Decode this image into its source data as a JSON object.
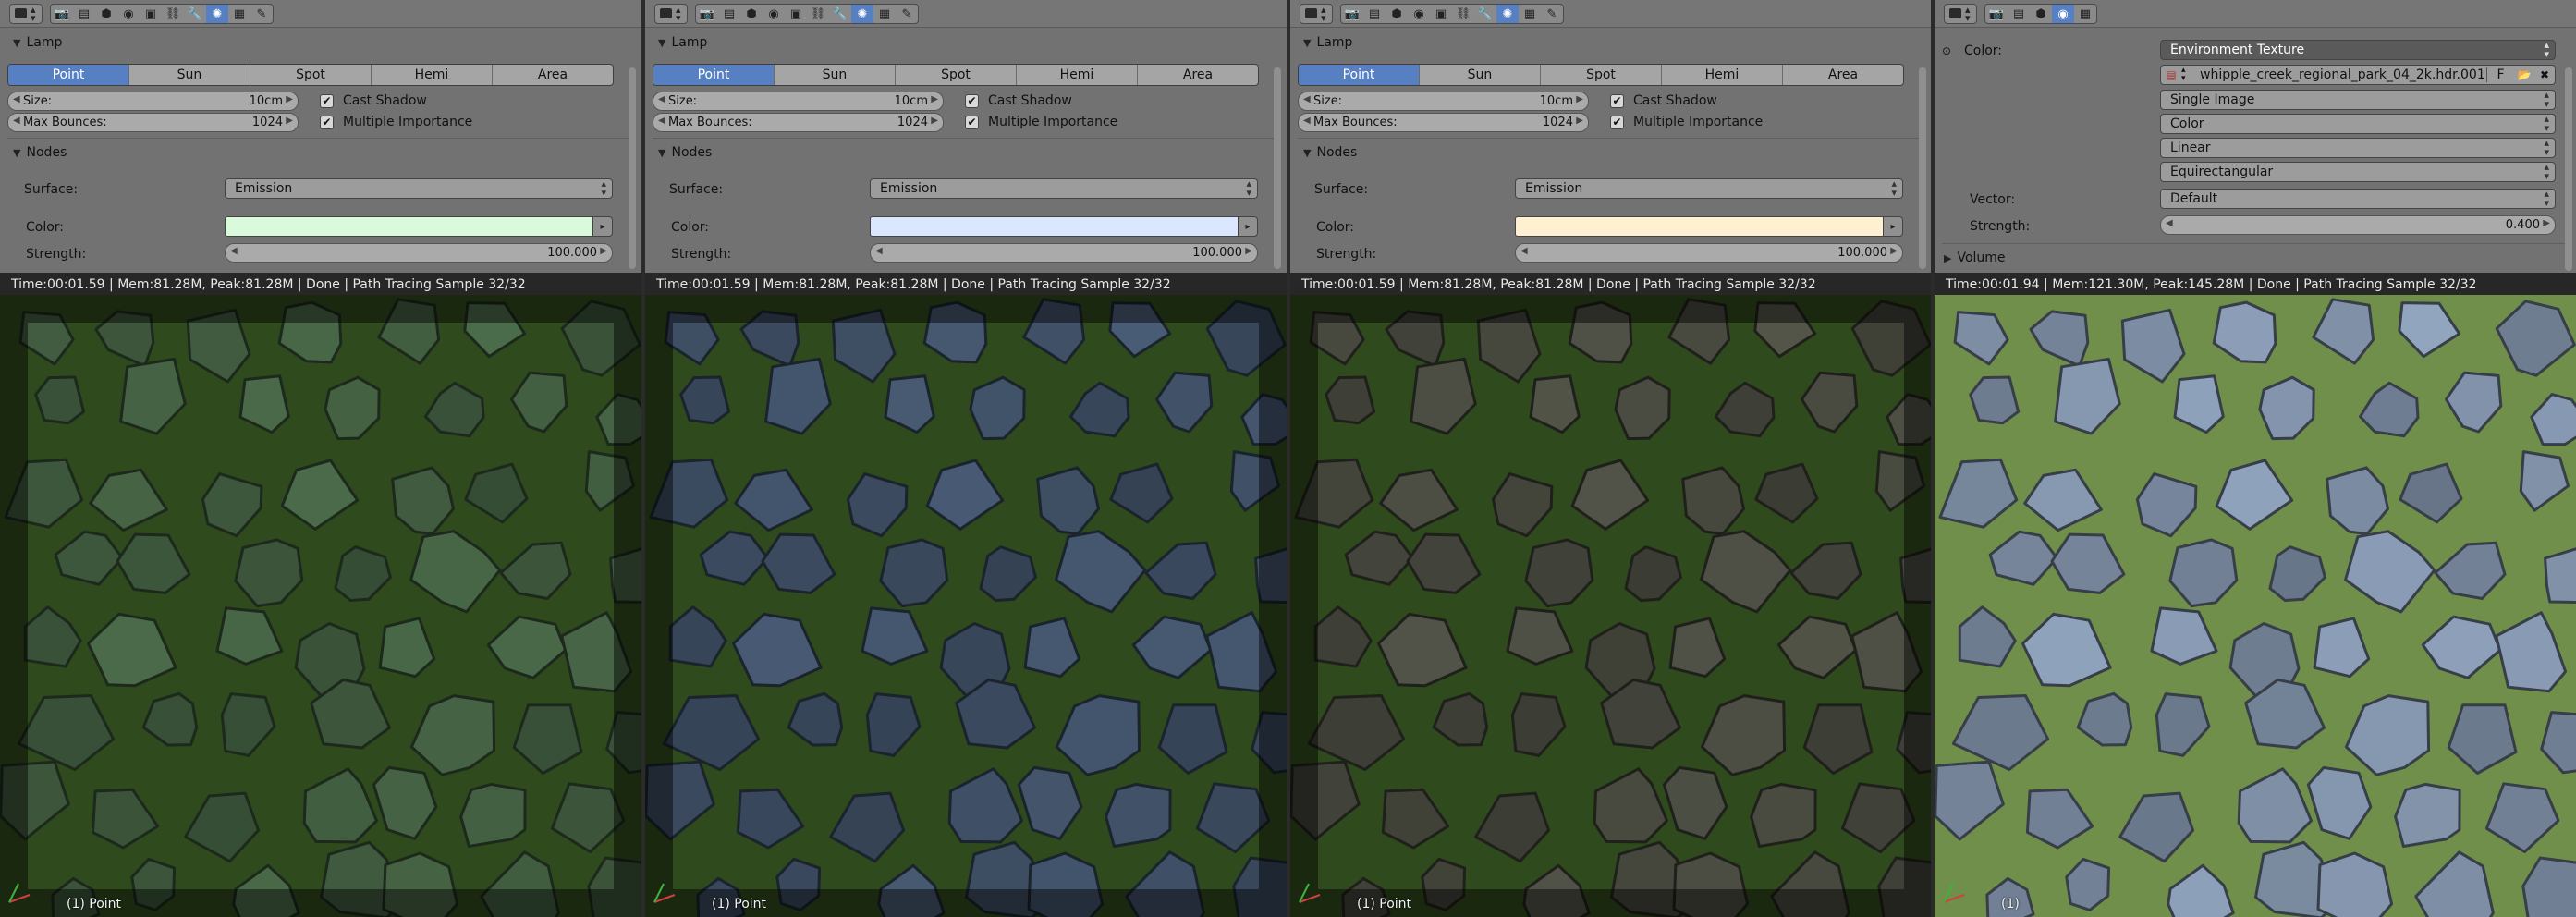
{
  "panels": [
    {
      "section_lamp": "Lamp",
      "lamp_types": [
        "Point",
        "Sun",
        "Spot",
        "Hemi",
        "Area"
      ],
      "active_type": "Point",
      "size_label": "Size:",
      "size_value": "10cm",
      "bounces_label": "Max Bounces:",
      "bounces_value": "1024",
      "cast_shadow": "Cast Shadow",
      "multiple_importance": "Multiple Importance",
      "section_nodes": "Nodes",
      "surface_label": "Surface:",
      "surface_value": "Emission",
      "color_label": "Color:",
      "color_hex": "#d9fbdc",
      "strength_label": "Strength:",
      "strength_value": "100.000",
      "status": "Time:00:01.59 | Mem:81.28M, Peak:81.28M | Done | Path Tracing Sample 32/32",
      "footer": "(1) Point",
      "tint": "#3f5a3e"
    },
    {
      "section_lamp": "Lamp",
      "lamp_types": [
        "Point",
        "Sun",
        "Spot",
        "Hemi",
        "Area"
      ],
      "active_type": "Point",
      "size_label": "Size:",
      "size_value": "10cm",
      "bounces_label": "Max Bounces:",
      "bounces_value": "1024",
      "cast_shadow": "Cast Shadow",
      "multiple_importance": "Multiple Importance",
      "section_nodes": "Nodes",
      "surface_label": "Surface:",
      "surface_value": "Emission",
      "color_label": "Color:",
      "color_hex": "#dbe7ff",
      "strength_label": "Strength:",
      "strength_value": "100.000",
      "status": "Time:00:01.59 | Mem:81.28M, Peak:81.28M | Done | Path Tracing Sample 32/32",
      "footer": "(1) Point",
      "tint": "#3d4d62"
    },
    {
      "section_lamp": "Lamp",
      "lamp_types": [
        "Point",
        "Sun",
        "Spot",
        "Hemi",
        "Area"
      ],
      "active_type": "Point",
      "size_label": "Size:",
      "size_value": "10cm",
      "bounces_label": "Max Bounces:",
      "bounces_value": "1024",
      "cast_shadow": "Cast Shadow",
      "multiple_importance": "Multiple Importance",
      "section_nodes": "Nodes",
      "surface_label": "Surface:",
      "surface_value": "Emission",
      "color_label": "Color:",
      "color_hex": "#fff0d2",
      "strength_label": "Strength:",
      "strength_value": "100.000",
      "status": "Time:00:01.59 | Mem:81.28M, Peak:81.28M | Done | Path Tracing Sample 32/32",
      "footer": "(1) Point",
      "tint": "#45473d"
    }
  ],
  "world": {
    "color_label": "Color:",
    "color_value": "Environment Texture",
    "image_name": "whipple_creek_regional_park_04_2k.hdr.001",
    "fake_user": "F",
    "source": "Single Image",
    "colorspace": "Color",
    "interpolation": "Linear",
    "projection": "Equirectangular",
    "vector_label": "Vector:",
    "vector_value": "Default",
    "strength_label": "Strength:",
    "strength_value": "0.400",
    "section_volume": "Volume",
    "status": "Time:00:01.94 | Mem:121.30M, Peak:145.28M | Done | Path Tracing Sample 32/32",
    "footer": "(1)",
    "tint": "#7a8aa0"
  },
  "icons": [
    "editor-type-icon",
    "render-tab-icon",
    "layers-tab-icon",
    "scene-tab-icon",
    "world-tab-icon",
    "object-tab-icon",
    "constraints-tab-icon",
    "modifiers-tab-icon",
    "data-tab-icon",
    "material-tab-icon",
    "texture-tab-icon",
    "particles-tab-icon"
  ]
}
